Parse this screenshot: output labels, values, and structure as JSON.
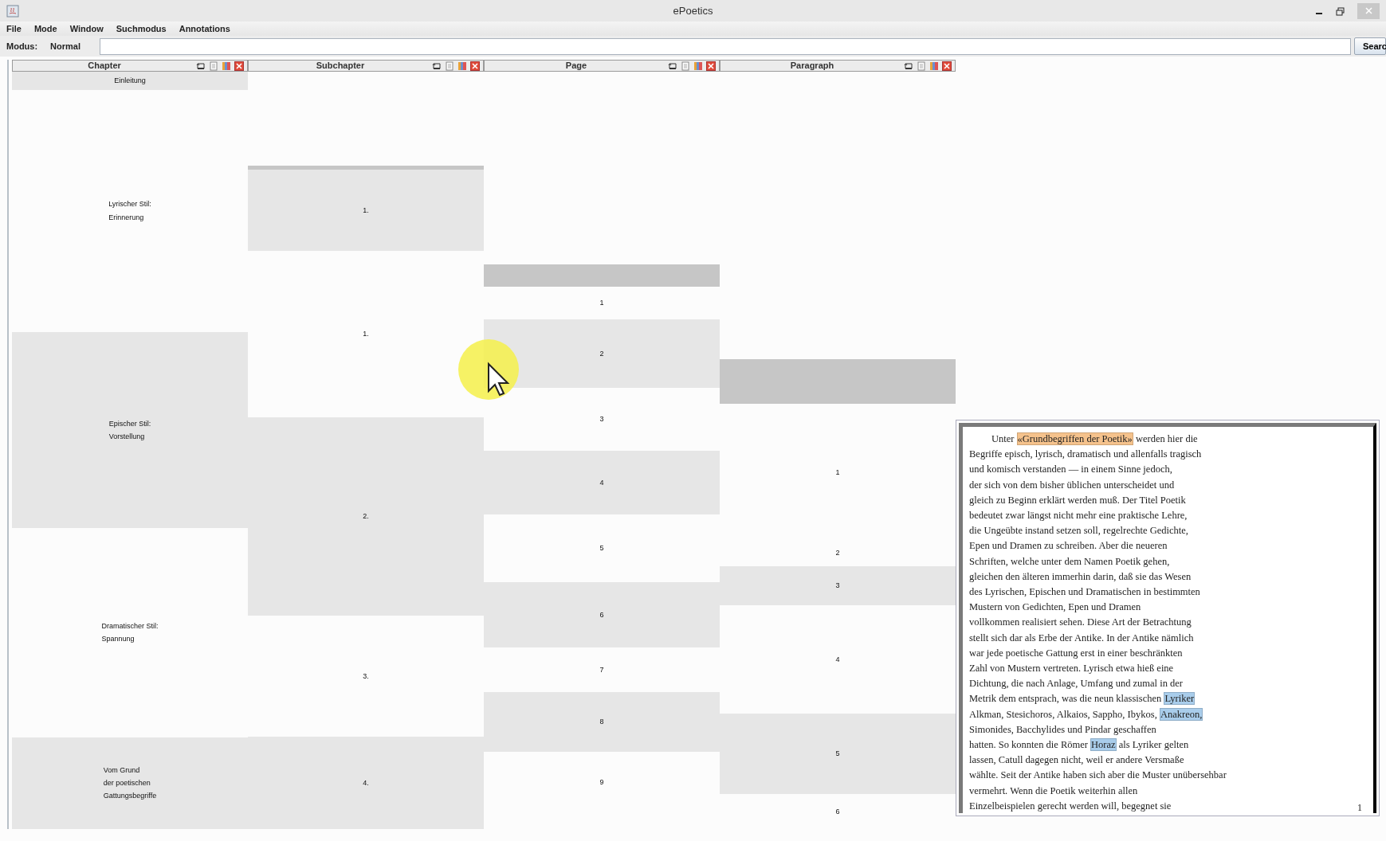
{
  "window": {
    "title": "ePoetics"
  },
  "menu": [
    "File",
    "Mode",
    "Window",
    "Suchmodus",
    "Annotations"
  ],
  "toolbar": {
    "mode_label": "Modus:",
    "mode_value": "Normal",
    "search_button": "Searc"
  },
  "columns": [
    {
      "title": "Chapter",
      "cells": [
        {
          "lines": [
            "Einleitung"
          ],
          "shaded": true,
          "selected": false
        },
        {
          "lines": [
            "Lyrischer Stil:",
            "Erinnerung"
          ],
          "shaded": false,
          "selected": false
        },
        {
          "lines": [
            "Epischer Stil:",
            "Vorstellung"
          ],
          "shaded": true,
          "selected": false
        },
        {
          "lines": [
            "Dramatischer Stil:",
            "Spannung"
          ],
          "shaded": false,
          "selected": false
        },
        {
          "lines": [
            "Vom Grund",
            "der poetischen",
            "Gattungsbegriffe"
          ],
          "shaded": true,
          "selected": false
        }
      ]
    },
    {
      "title": "Subchapter",
      "cells": [
        {
          "lines": [
            "1."
          ],
          "shaded": true,
          "selected": true
        },
        {
          "lines": [
            "1."
          ],
          "shaded": false,
          "selected": false
        },
        {
          "lines": [
            "2."
          ],
          "shaded": true,
          "selected": false
        },
        {
          "lines": [
            "3."
          ],
          "shaded": false,
          "selected": false
        },
        {
          "lines": [
            "4."
          ],
          "shaded": true,
          "selected": false
        }
      ]
    },
    {
      "title": "Page",
      "cells": [
        {
          "lines": [
            "1"
          ],
          "shaded": false,
          "selected": true
        },
        {
          "lines": [
            "2"
          ],
          "shaded": true,
          "selected": false
        },
        {
          "lines": [
            "3"
          ],
          "shaded": false,
          "selected": false
        },
        {
          "lines": [
            "4"
          ],
          "shaded": true,
          "selected": false
        },
        {
          "lines": [
            "5"
          ],
          "shaded": false,
          "selected": false
        },
        {
          "lines": [
            "6"
          ],
          "shaded": true,
          "selected": false
        },
        {
          "lines": [
            "7"
          ],
          "shaded": false,
          "selected": false
        },
        {
          "lines": [
            "8"
          ],
          "shaded": true,
          "selected": false
        },
        {
          "lines": [
            "9"
          ],
          "shaded": false,
          "selected": false
        }
      ]
    },
    {
      "title": "Paragraph",
      "cells": [
        {
          "lines": [
            "1"
          ],
          "shaded": false,
          "selected": true
        },
        {
          "lines": [
            "2"
          ],
          "shaded": false,
          "selected": false
        },
        {
          "lines": [
            "3"
          ],
          "shaded": true,
          "selected": false
        },
        {
          "lines": [
            "4"
          ],
          "shaded": false,
          "selected": false
        },
        {
          "lines": [
            "5"
          ],
          "shaded": true,
          "selected": false
        },
        {
          "lines": [
            "6"
          ],
          "shaded": false,
          "selected": false
        }
      ]
    }
  ],
  "text_panel": {
    "page_number": "1",
    "lines": [
      [
        {
          "text": "Unter "
        },
        {
          "text": "«Grundbegriffen der Poetik»",
          "color": "#f5c28c"
        },
        {
          "text": " werden hier die"
        }
      ],
      [
        {
          "text": "Begriffe episch, lyrisch, dramatisch und allenfalls tragisch"
        }
      ],
      [
        {
          "text": "und komisch verstanden — in einem Sinne jedoch,"
        }
      ],
      [
        {
          "text": "der sich von dem bisher üblichen unterscheidet und"
        }
      ],
      [
        {
          "text": "gleich zu Beginn erklärt werden muß. Der Titel Poetik"
        }
      ],
      [
        {
          "text": "bedeutet zwar längst nicht mehr eine praktische Lehre,"
        }
      ],
      [
        {
          "text": "die Ungeübte instand setzen soll, regelrechte Gedichte,"
        }
      ],
      [
        {
          "text": "Epen und Dramen zu schreiben. Aber die neueren"
        }
      ],
      [
        {
          "text": "Schriften, welche unter dem Namen Poetik gehen,"
        }
      ],
      [
        {
          "text": "gleichen den älteren immerhin darin, daß sie das Wesen"
        }
      ],
      [
        {
          "text": "des Lyrischen, Epischen und Dramatischen in bestimmten"
        }
      ],
      [
        {
          "text": "Mustern von Gedichten, Epen und Dramen"
        }
      ],
      [
        {
          "text": "vollkommen realisiert sehen. Diese Art der Betrachtung"
        }
      ],
      [
        {
          "text": "stellt sich dar als Erbe der Antike. In der Antike nämlich"
        }
      ],
      [
        {
          "text": "war jede poetische Gattung erst in einer beschränkten"
        }
      ],
      [
        {
          "text": "Zahl von Mustern vertreten. Lyrisch etwa hieß eine"
        }
      ],
      [
        {
          "text": "Dichtung, die nach Anlage, Umfang und zumal in der"
        }
      ],
      [
        {
          "text": "Metrik dem entsprach, was die neun klassischen "
        },
        {
          "text": "Lyriker",
          "color": "#a9cdeb"
        }
      ],
      [
        {
          "text": "Alkman, Stesichoros, Alkaios, Sappho, Ibykos, "
        },
        {
          "text": "Anakreon,",
          "color": "#a9cdeb"
        }
      ],
      [
        {
          "text": "Simonides, Bacchylides und Pindar geschaffen"
        }
      ],
      [
        {
          "text": "hatten. So konnten die Römer "
        },
        {
          "text": "Horaz",
          "color": "#a9cdeb"
        },
        {
          "text": " als Lyriker gelten"
        }
      ],
      [
        {
          "text": "lassen, Catull dagegen nicht, weil er andere Versmaße"
        }
      ],
      [
        {
          "text": "wählte. Seit der Antike haben sich aber die Muster unübersehbar"
        }
      ],
      [
        {
          "text": "vermehrt. Wenn die Poetik weiterhin allen"
        }
      ],
      [
        {
          "text": "Einzelbeispielen gerecht werden will, begegnet sie"
        }
      ]
    ]
  }
}
